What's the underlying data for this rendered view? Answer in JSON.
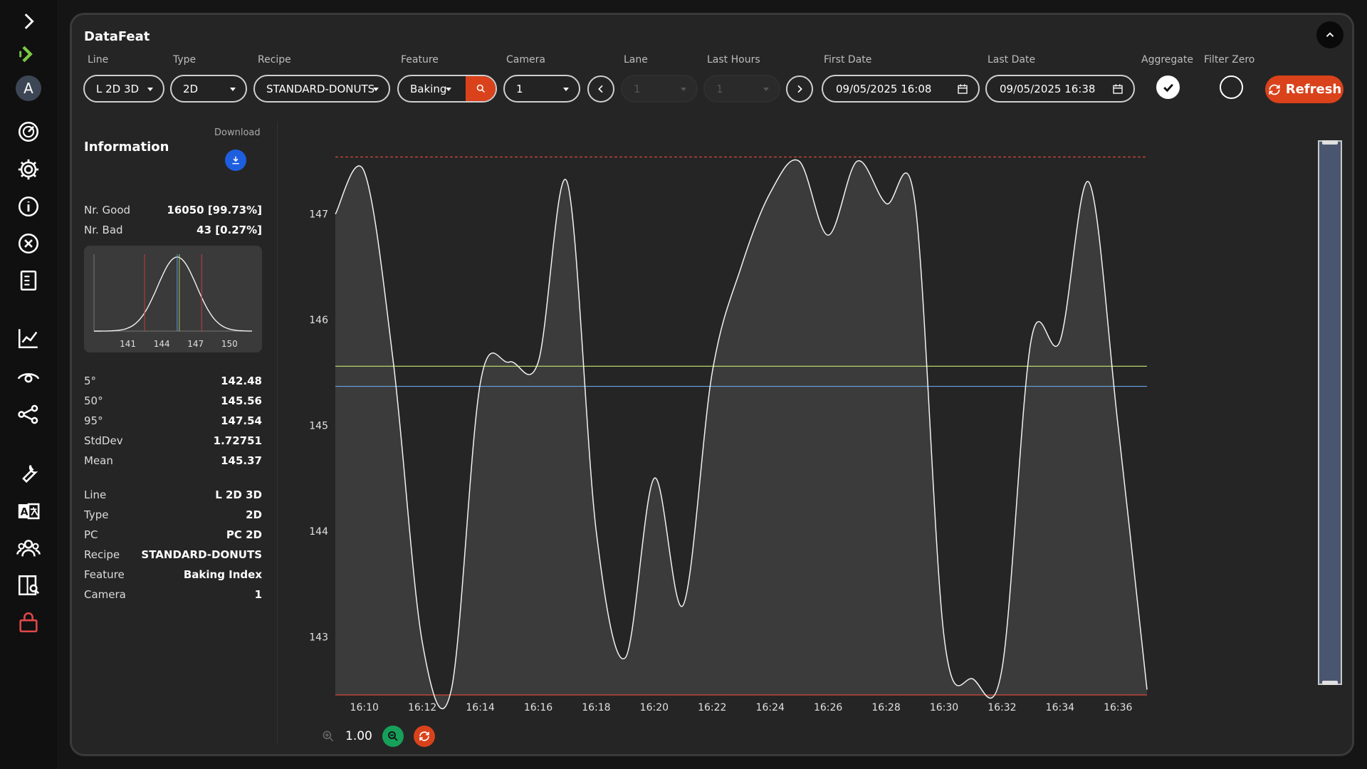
{
  "app": {
    "title": "DataFeat"
  },
  "sidebar": {
    "avatar_letter": "A",
    "items": [
      "expand-icon",
      "play-next-icon",
      "avatar",
      "gauge-icon",
      "settings-icon",
      "info-icon",
      "close-circle-icon",
      "document-icon",
      "line-chart-icon",
      "eye-icon",
      "share-network-icon",
      "wrench-icon",
      "translate-icon",
      "users-icon",
      "book-search-icon",
      "lock-icon"
    ]
  },
  "filters": {
    "line": {
      "label": "Line",
      "value": "L 2D 3D"
    },
    "type": {
      "label": "Type",
      "value": "2D"
    },
    "recipe": {
      "label": "Recipe",
      "value": "STANDARD-DONUTS"
    },
    "feature": {
      "label": "Feature",
      "value": "Baking"
    },
    "camera": {
      "label": "Camera",
      "value": "1"
    },
    "lane": {
      "label": "Lane",
      "value": "1"
    },
    "last_hours": {
      "label": "Last Hours",
      "value": "1"
    },
    "first_date": {
      "label": "First Date",
      "value": "09/05/2025 16:08"
    },
    "last_date": {
      "label": "Last Date",
      "value": "09/05/2025 16:38"
    },
    "aggregate": {
      "label": "Aggregate",
      "checked": true
    },
    "filter_zero": {
      "label": "Filter Zero",
      "checked": false
    },
    "refresh_label": "Refresh"
  },
  "info": {
    "title": "Information",
    "download_label": "Download",
    "counts": [
      {
        "k": "Nr. Good",
        "v": "16050 [99.73%]"
      },
      {
        "k": "Nr. Bad",
        "v": "43 [0.27%]"
      }
    ],
    "stats": [
      {
        "k": "5°",
        "v": "142.48"
      },
      {
        "k": "50°",
        "v": "145.56"
      },
      {
        "k": "95°",
        "v": "147.54"
      },
      {
        "k": "StdDev",
        "v": "1.72751"
      },
      {
        "k": "Mean",
        "v": "145.37"
      }
    ],
    "details": [
      {
        "k": "Line",
        "v": "L 2D 3D"
      },
      {
        "k": "Type",
        "v": "2D"
      },
      {
        "k": "PC",
        "v": "PC 2D"
      },
      {
        "k": "Recipe",
        "v": "STANDARD-DONUTS"
      },
      {
        "k": "Feature",
        "v": "Baking Index"
      },
      {
        "k": "Camera",
        "v": "1"
      }
    ],
    "histogram": {
      "ticks": [
        "141",
        "144",
        "147",
        "150"
      ],
      "tick_values": [
        141,
        144,
        147,
        150
      ],
      "xlim": [
        138,
        152
      ],
      "mean": 145.37,
      "stddev": 1.72751,
      "p5": 142.48,
      "p50": 145.56,
      "p95": 147.54
    }
  },
  "chart_data": {
    "type": "area",
    "xlim": [
      "16:09",
      "16:37"
    ],
    "ylim": [
      142.45,
      147.55
    ],
    "yticks": [
      143,
      144,
      145,
      146,
      147
    ],
    "xticks": [
      "16:10",
      "16:12",
      "16:14",
      "16:16",
      "16:18",
      "16:20",
      "16:22",
      "16:24",
      "16:26",
      "16:28",
      "16:30",
      "16:32",
      "16:34",
      "16:36"
    ],
    "reference_lines": [
      {
        "name": "upper",
        "value": 147.54,
        "color": "#d64a3a",
        "style": "dashed"
      },
      {
        "name": "p50",
        "value": 145.56,
        "color": "#b5d66a"
      },
      {
        "name": "mean",
        "value": 145.37,
        "color": "#6aa3e6"
      },
      {
        "name": "lower",
        "value": 142.45,
        "color": "#d64a3a"
      }
    ],
    "series": [
      {
        "x": [
          "16:09",
          "16:10",
          "16:11",
          "16:12",
          "16:13",
          "16:14",
          "16:15",
          "16:16",
          "16:17",
          "16:18",
          "16:19",
          "16:20",
          "16:21",
          "16:22",
          "16:23",
          "16:24",
          "16:25",
          "16:26",
          "16:27",
          "16:28",
          "16:29",
          "16:30",
          "16:31",
          "16:32",
          "16:33",
          "16:34",
          "16:35",
          "16:36",
          "16:37"
        ],
        "y": [
          147.0,
          147.4,
          145.6,
          142.95,
          142.5,
          145.4,
          145.6,
          145.6,
          147.3,
          144.0,
          142.8,
          144.5,
          143.3,
          145.5,
          146.5,
          147.2,
          147.5,
          146.8,
          147.5,
          147.1,
          147.1,
          143.0,
          142.6,
          142.7,
          145.8,
          145.8,
          147.3,
          145.0,
          142.5
        ]
      }
    ]
  },
  "zoom": {
    "value": "1.00"
  }
}
